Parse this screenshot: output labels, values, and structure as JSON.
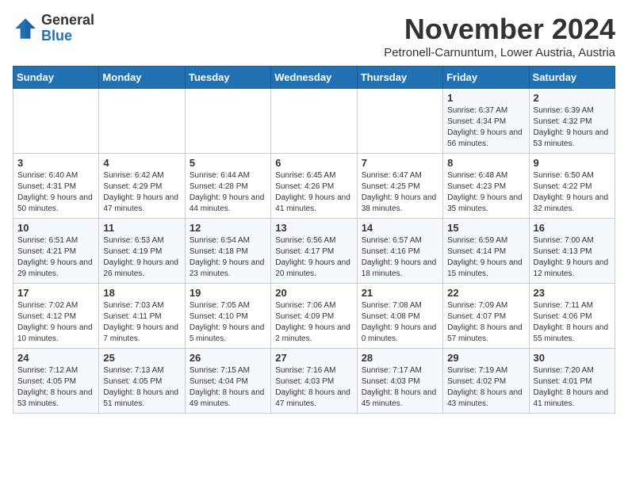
{
  "header": {
    "logo_line1": "General",
    "logo_line2": "Blue",
    "month": "November 2024",
    "location": "Petronell-Carnuntum, Lower Austria, Austria"
  },
  "weekdays": [
    "Sunday",
    "Monday",
    "Tuesday",
    "Wednesday",
    "Thursday",
    "Friday",
    "Saturday"
  ],
  "weeks": [
    [
      {
        "day": "",
        "info": ""
      },
      {
        "day": "",
        "info": ""
      },
      {
        "day": "",
        "info": ""
      },
      {
        "day": "",
        "info": ""
      },
      {
        "day": "",
        "info": ""
      },
      {
        "day": "1",
        "info": "Sunrise: 6:37 AM\nSunset: 4:34 PM\nDaylight: 9 hours and 56 minutes."
      },
      {
        "day": "2",
        "info": "Sunrise: 6:39 AM\nSunset: 4:32 PM\nDaylight: 9 hours and 53 minutes."
      }
    ],
    [
      {
        "day": "3",
        "info": "Sunrise: 6:40 AM\nSunset: 4:31 PM\nDaylight: 9 hours and 50 minutes."
      },
      {
        "day": "4",
        "info": "Sunrise: 6:42 AM\nSunset: 4:29 PM\nDaylight: 9 hours and 47 minutes."
      },
      {
        "day": "5",
        "info": "Sunrise: 6:44 AM\nSunset: 4:28 PM\nDaylight: 9 hours and 44 minutes."
      },
      {
        "day": "6",
        "info": "Sunrise: 6:45 AM\nSunset: 4:26 PM\nDaylight: 9 hours and 41 minutes."
      },
      {
        "day": "7",
        "info": "Sunrise: 6:47 AM\nSunset: 4:25 PM\nDaylight: 9 hours and 38 minutes."
      },
      {
        "day": "8",
        "info": "Sunrise: 6:48 AM\nSunset: 4:23 PM\nDaylight: 9 hours and 35 minutes."
      },
      {
        "day": "9",
        "info": "Sunrise: 6:50 AM\nSunset: 4:22 PM\nDaylight: 9 hours and 32 minutes."
      }
    ],
    [
      {
        "day": "10",
        "info": "Sunrise: 6:51 AM\nSunset: 4:21 PM\nDaylight: 9 hours and 29 minutes."
      },
      {
        "day": "11",
        "info": "Sunrise: 6:53 AM\nSunset: 4:19 PM\nDaylight: 9 hours and 26 minutes."
      },
      {
        "day": "12",
        "info": "Sunrise: 6:54 AM\nSunset: 4:18 PM\nDaylight: 9 hours and 23 minutes."
      },
      {
        "day": "13",
        "info": "Sunrise: 6:56 AM\nSunset: 4:17 PM\nDaylight: 9 hours and 20 minutes."
      },
      {
        "day": "14",
        "info": "Sunrise: 6:57 AM\nSunset: 4:16 PM\nDaylight: 9 hours and 18 minutes."
      },
      {
        "day": "15",
        "info": "Sunrise: 6:59 AM\nSunset: 4:14 PM\nDaylight: 9 hours and 15 minutes."
      },
      {
        "day": "16",
        "info": "Sunrise: 7:00 AM\nSunset: 4:13 PM\nDaylight: 9 hours and 12 minutes."
      }
    ],
    [
      {
        "day": "17",
        "info": "Sunrise: 7:02 AM\nSunset: 4:12 PM\nDaylight: 9 hours and 10 minutes."
      },
      {
        "day": "18",
        "info": "Sunrise: 7:03 AM\nSunset: 4:11 PM\nDaylight: 9 hours and 7 minutes."
      },
      {
        "day": "19",
        "info": "Sunrise: 7:05 AM\nSunset: 4:10 PM\nDaylight: 9 hours and 5 minutes."
      },
      {
        "day": "20",
        "info": "Sunrise: 7:06 AM\nSunset: 4:09 PM\nDaylight: 9 hours and 2 minutes."
      },
      {
        "day": "21",
        "info": "Sunrise: 7:08 AM\nSunset: 4:08 PM\nDaylight: 9 hours and 0 minutes."
      },
      {
        "day": "22",
        "info": "Sunrise: 7:09 AM\nSunset: 4:07 PM\nDaylight: 8 hours and 57 minutes."
      },
      {
        "day": "23",
        "info": "Sunrise: 7:11 AM\nSunset: 4:06 PM\nDaylight: 8 hours and 55 minutes."
      }
    ],
    [
      {
        "day": "24",
        "info": "Sunrise: 7:12 AM\nSunset: 4:05 PM\nDaylight: 8 hours and 53 minutes."
      },
      {
        "day": "25",
        "info": "Sunrise: 7:13 AM\nSunset: 4:05 PM\nDaylight: 8 hours and 51 minutes."
      },
      {
        "day": "26",
        "info": "Sunrise: 7:15 AM\nSunset: 4:04 PM\nDaylight: 8 hours and 49 minutes."
      },
      {
        "day": "27",
        "info": "Sunrise: 7:16 AM\nSunset: 4:03 PM\nDaylight: 8 hours and 47 minutes."
      },
      {
        "day": "28",
        "info": "Sunrise: 7:17 AM\nSunset: 4:03 PM\nDaylight: 8 hours and 45 minutes."
      },
      {
        "day": "29",
        "info": "Sunrise: 7:19 AM\nSunset: 4:02 PM\nDaylight: 8 hours and 43 minutes."
      },
      {
        "day": "30",
        "info": "Sunrise: 7:20 AM\nSunset: 4:01 PM\nDaylight: 8 hours and 41 minutes."
      }
    ]
  ]
}
